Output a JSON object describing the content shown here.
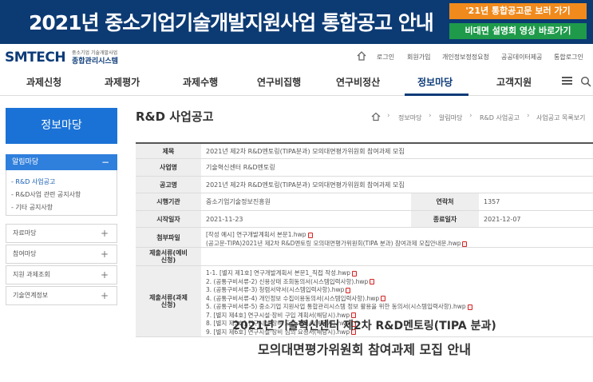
{
  "banner": {
    "title": "2021년 중소기업기술개발지원사업 통합공고 안내",
    "btn_notice": "'21년 통합공고문 보러 가기",
    "btn_video": "비대면 설명회 영상 바로가기"
  },
  "header": {
    "logo": "SMTECH",
    "logo_sub1": "중소기업 기술개발사업",
    "logo_sub2": "종합관리시스템",
    "util_links": [
      "로그인",
      "회원가입",
      "개인정보정정요청",
      "공공데이터제공",
      "통합로그인"
    ]
  },
  "gnb": {
    "items": [
      "과제신청",
      "과제평가",
      "과제수행",
      "연구비집행",
      "연구비정산",
      "정보마당",
      "고객지원"
    ],
    "active": "정보마당"
  },
  "sidebar": {
    "title": "정보마당",
    "group_open": "알림마당",
    "sub_items": [
      "- R&D 사업공고",
      "- R&D사업 관련 공지사항",
      "- 기타 공지사항"
    ],
    "menus": [
      "자료마당",
      "참여마당",
      "지원 과제조회",
      "기술연계정보"
    ]
  },
  "page": {
    "title": "R&D 사업공고",
    "breadcrumb": [
      "정보마당",
      "알림마당",
      "R&D 사업공고",
      "사업공고 목록보기"
    ]
  },
  "table": {
    "title_label": "제목",
    "title_value": "2021년 제2차 R&D멘토링(TIPA분과) 모의대면평가위원회 참여과제 모집",
    "project_label": "사업명",
    "project_value": "기술혁신센터 R&D멘토링",
    "notice_label": "공고명",
    "notice_value": "2021년 제2차 R&D멘토링(TIPA분과) 모의대면평가위원회 참여과제 모집",
    "agency_label": "시행기관",
    "agency_value": "중소기업기술정보진흥원",
    "contact_label": "연락처",
    "contact_value": "1357",
    "start_label": "시작일자",
    "start_value": "2021-11-23",
    "end_label": "종료일자",
    "end_value": "2021-12-07",
    "attach_label": "첨부파일",
    "attach_files": [
      "[작성 예시] 연구개발계획서 본문1.hwp",
      "(공고문-TIPA)2021년 제2차 R&D멘토링 모의대면평가위원회(TIPA 분과) 참여과제 모집안내문.hwp"
    ],
    "submit_pre_label": "제출서류(예비신청)",
    "submit_label": "제출서류(과제신청)",
    "submit_files": [
      "1-1. [별지 제1호] 연구개발계획서 본문1_직접 작성.hwp",
      "2. (공통구비서류-2) 신용상태 조회동의서(시스템입력사항).hwp",
      "3. (공통구비서류-3) 청렴서약서(시스템입력사항).hwp",
      "4. (공통구비서류-4) 개인정보 수집이용동의서(시스템입력사항).hwp",
      "5. (공통구비서류-5) 중소기업 지원사업 통합관리시스템 정보 활용을 위한 동의서(시스템입력사항).hwp",
      "7. [별지 제4호] 연구시설·장비 구입 계획서(해당시).hwp",
      "8. [별지 제5호] 연구시설·장비 도입 계획서(해당시).hwp",
      "9. [별지 제6호] 연구시설·장비 심의 요청서(해당시).hwp"
    ]
  },
  "content": {
    "title1": "2021년 기술혁신센터 제2차 R&D멘토링(TIPA 분과)",
    "title2": "모의대면평가위원회 참여과제 모집 안내"
  },
  "colors": {
    "navy": "#0c3a73",
    "blue": "#1a72d6",
    "orange": "#f08a1c",
    "green": "#1e9a4a"
  }
}
